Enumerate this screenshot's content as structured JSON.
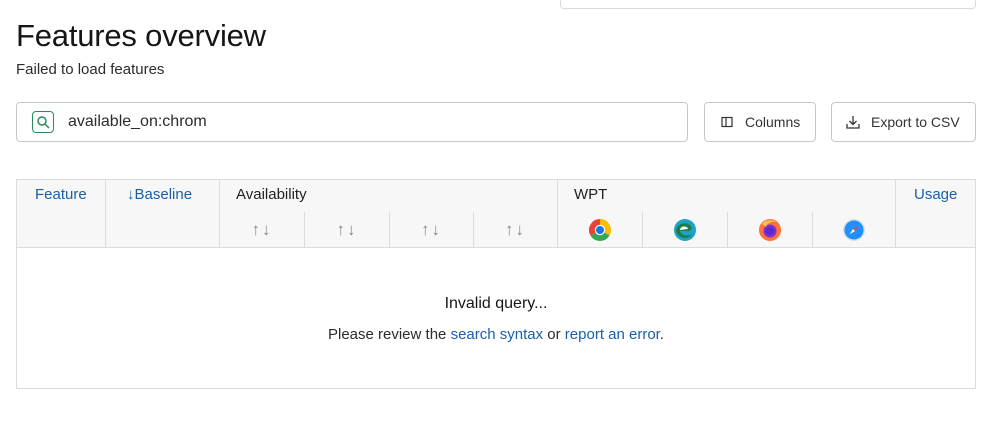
{
  "page": {
    "title": "Features overview",
    "subtitle": "Failed to load features"
  },
  "search": {
    "value": "available_on:chrom",
    "icon": "search-icon"
  },
  "toolbar": {
    "columns_label": "Columns",
    "export_label": "Export to CSV"
  },
  "table": {
    "headers": {
      "feature": "Feature",
      "baseline_arrow": "↓",
      "baseline": "Baseline",
      "availability": "Availability",
      "wpt": "WPT",
      "usage": "Usage"
    },
    "sort_glyph": "↑↓",
    "browsers": [
      "chrome",
      "edge",
      "firefox",
      "safari"
    ],
    "empty": {
      "title": "Invalid query...",
      "msg_prefix": "Please review the ",
      "link1": "search syntax",
      "msg_middle": " or ",
      "link2": "report an error",
      "msg_suffix": "."
    }
  },
  "colors": {
    "link": "#1a5fa8",
    "search_icon": "#2e8b57"
  }
}
